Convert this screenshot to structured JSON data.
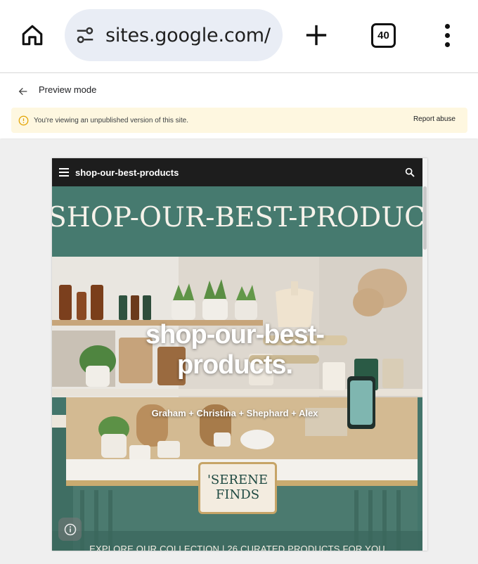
{
  "browser": {
    "url": "sites.google.com/",
    "tab_count": "40"
  },
  "preview_bar": {
    "mode_label": "Preview mode",
    "banner_text": "You're viewing an unpublished version of this site.",
    "report_label": "Report abuse"
  },
  "site": {
    "nav_title": "shop-our-best-products",
    "banner_text": "SHOP-OUR-BEST-PRODUCTS",
    "hero_title": "shop-our-best-products.",
    "hero_subtitle": "Graham + Christina + Shephard + Alex",
    "brand_sign": "'SERENE\nFINDS",
    "collection_text": "EXPLORE OUR COLLECTION | 26 CURATED PRODUCTS FOR YOU"
  },
  "icons": [
    "home-icon",
    "site-info-icon",
    "plus-icon",
    "tab-switcher-icon",
    "more-vert-icon",
    "back-arrow-icon",
    "info-circle-icon",
    "hamburger-icon",
    "search-icon",
    "info-icon"
  ]
}
